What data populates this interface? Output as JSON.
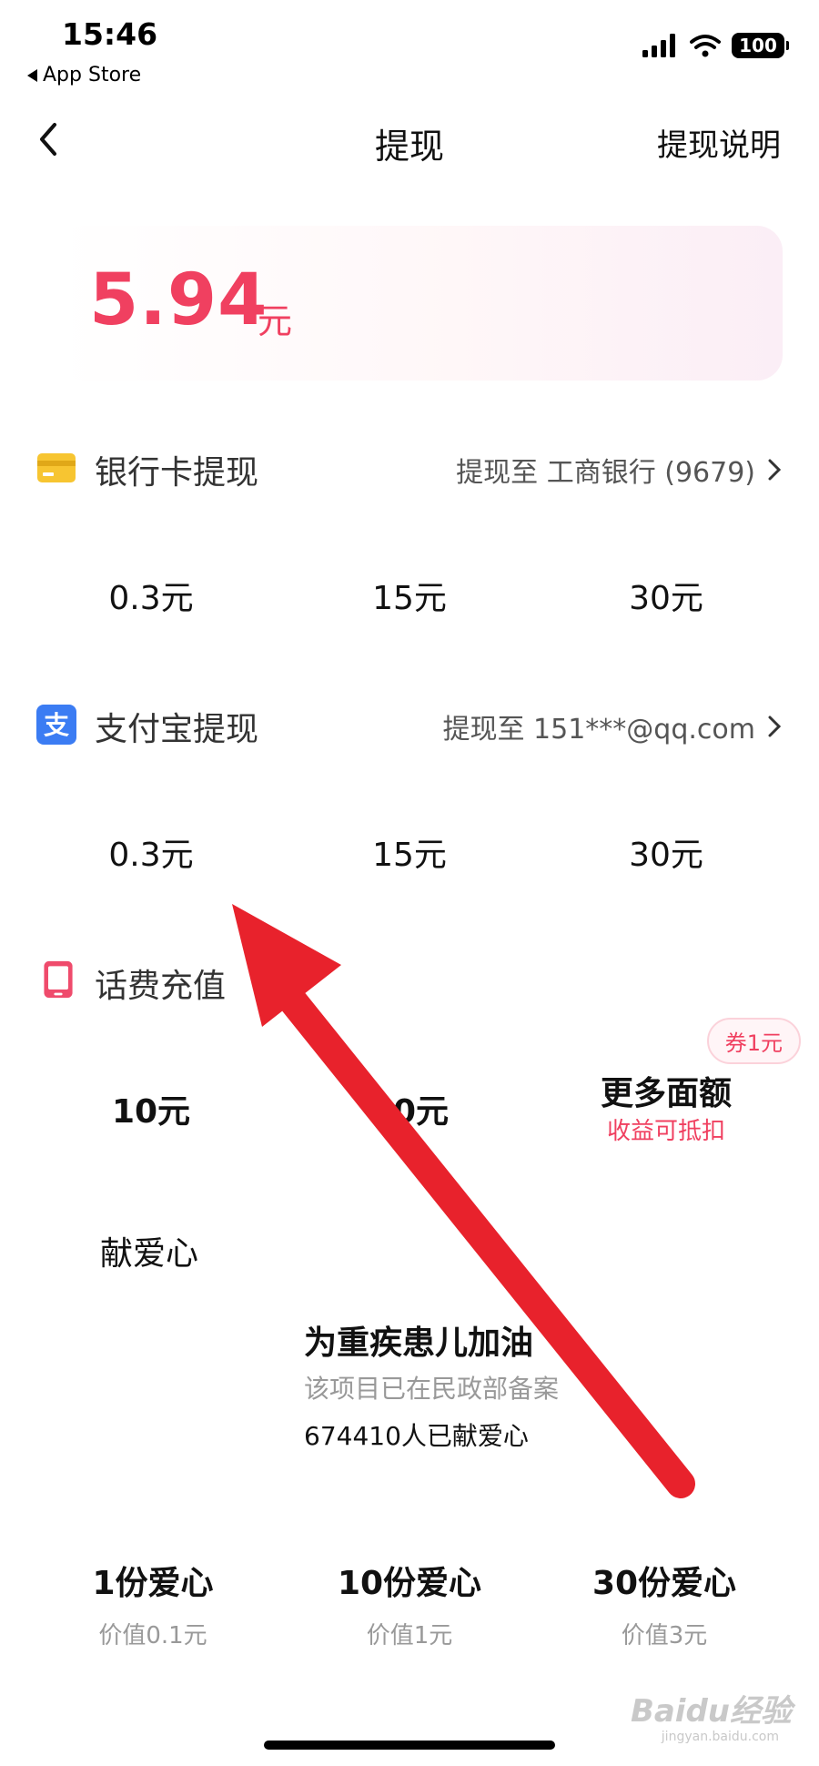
{
  "status_bar": {
    "time": "15:46",
    "back_app": "App Store",
    "battery": "100"
  },
  "nav": {
    "title": "提现",
    "help": "提现说明"
  },
  "balance": {
    "amount": "5.94",
    "unit": "元"
  },
  "bank": {
    "title": "银行卡提现",
    "dest": "提现至 工商银行 (9679)",
    "options": [
      "0.3元",
      "15元",
      "30元"
    ]
  },
  "alipay": {
    "title": "支付宝提现",
    "dest": "提现至 151***@qq.com",
    "options": [
      "0.3元",
      "15元",
      "30元"
    ]
  },
  "phone": {
    "title": "话费充值",
    "options": [
      "10元",
      "30元"
    ],
    "more_title": "更多面额",
    "more_sub": "收益可抵扣",
    "coupon": "券1元"
  },
  "donate": {
    "title": "献爱心",
    "project_name": "为重疾患儿加油",
    "project_note": "该项目已在民政部备案",
    "project_count": "674410人已献爱心",
    "options": [
      {
        "title": "1份爱心",
        "sub": "价值0.1元"
      },
      {
        "title": "10份爱心",
        "sub": "价值1元"
      },
      {
        "title": "30份爱心",
        "sub": "价值3元"
      }
    ]
  },
  "watermark": {
    "text": "Baidu经验",
    "sub": "jingyan.baidu.com"
  },
  "colors": {
    "accent": "#f04060",
    "arrow": "#e8222c",
    "bank_icon": "#f7c531",
    "alipay_icon": "#3b7cf3"
  }
}
